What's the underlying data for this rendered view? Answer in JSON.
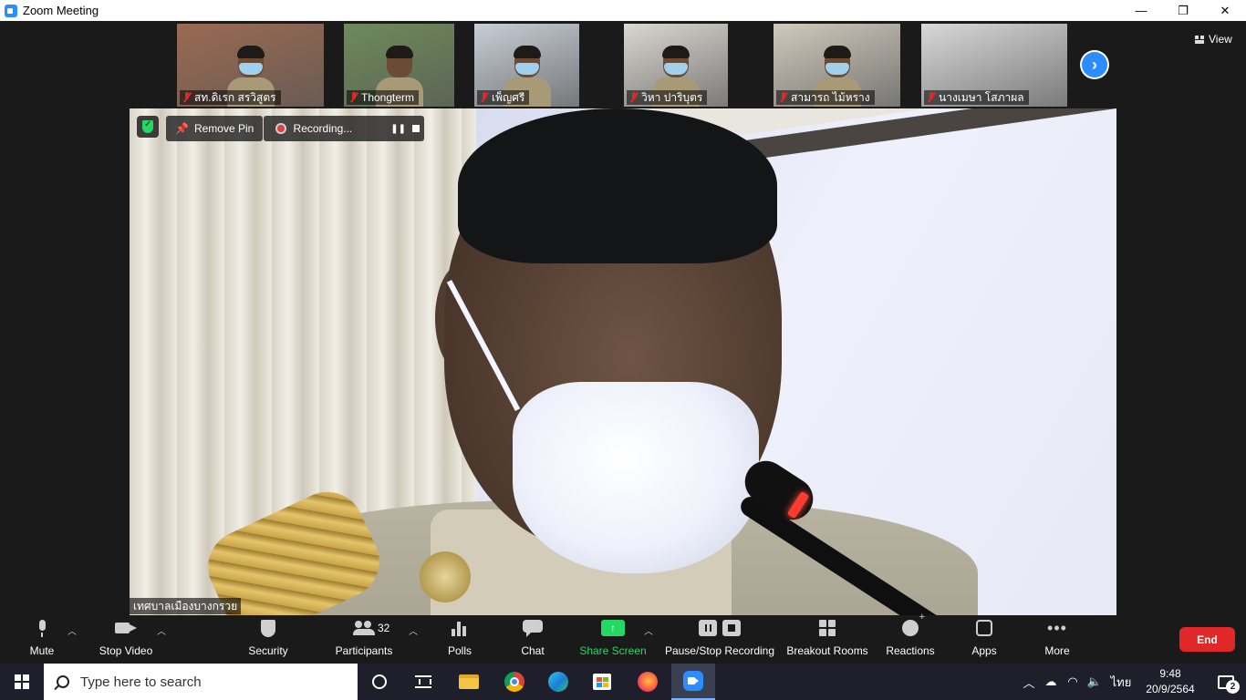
{
  "window": {
    "title": "Zoom Meeting",
    "minimize_glyph": "—",
    "restore_glyph": "❐",
    "close_glyph": "✕"
  },
  "view_button": {
    "label": "View"
  },
  "thumbnails": [
    {
      "name": "สท.ดิเรก สรวิสูตร",
      "bg": "#9b6a52"
    },
    {
      "name": "Thongterm",
      "bg": "#6e8a5a"
    },
    {
      "name": "เพ็ญศรี",
      "bg": "#c7ced6"
    },
    {
      "name": "วิหา ปาริบุตร",
      "bg": "#d9d7d0"
    },
    {
      "name": "สามารถ ไม้หราง",
      "bg": "#cfc9bd"
    },
    {
      "name": "นางเมษา โสภาผล",
      "bg": "#d8d8d8"
    }
  ],
  "main_video": {
    "remove_pin_label": "Remove Pin",
    "recording_label": "Recording...",
    "speaker_name": "เทศบาลเมืองบางกรวย"
  },
  "toolbar": {
    "mute_label": "Mute",
    "stop_video_label": "Stop Video",
    "security_label": "Security",
    "participants_label": "Participants",
    "participants_count": "32",
    "polls_label": "Polls",
    "chat_label": "Chat",
    "share_screen_label": "Share Screen",
    "pause_stop_recording_label": "Pause/Stop Recording",
    "breakout_rooms_label": "Breakout Rooms",
    "reactions_label": "Reactions",
    "apps_label": "Apps",
    "more_label": "More",
    "end_label": "End"
  },
  "taskbar": {
    "search_placeholder": "Type here to search",
    "language": "ไทย",
    "time": "9:48",
    "date": "20/9/2564",
    "notification_count": "2"
  },
  "colors": {
    "zoom_blue": "#2d8cff",
    "share_green": "#23d963",
    "end_red": "#e02828",
    "toolbar_bg": "#1a1a1a",
    "taskbar_bg": "#1f1f2b"
  }
}
